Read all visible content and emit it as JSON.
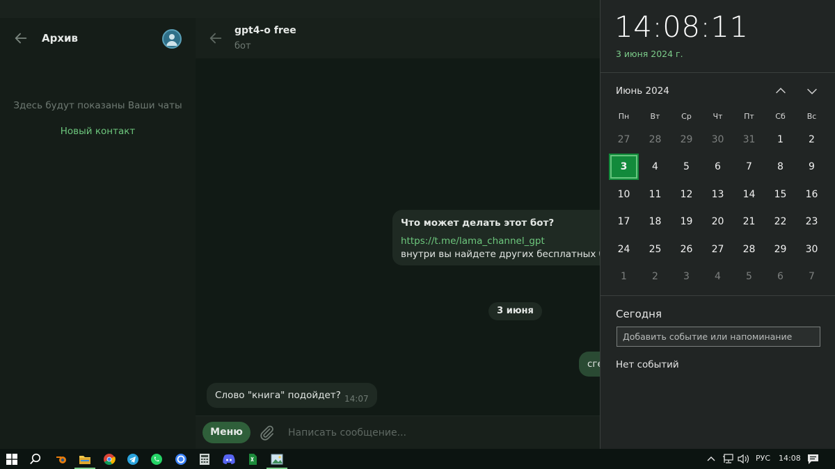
{
  "archive": {
    "title": "Архив",
    "empty_text": "Здесь будут показаны Ваши чаты",
    "new_contact": "Новый контакт"
  },
  "chat": {
    "name": "gpt4-o free",
    "status": "бот",
    "info_bubble": {
      "question": "Что может делать этот бот?",
      "link": "https://t.me/lama_channel_gpt",
      "description": "внутри вы найдете других бесплатных бо"
    },
    "date_divider": "3 июня",
    "outgoing_message": "сге",
    "incoming_message": {
      "text": "Слово \"книга\" подойдет?",
      "time": "14:07"
    },
    "composer": {
      "menu_label": "Меню",
      "placeholder": "Написать сообщение..."
    }
  },
  "calendar": {
    "time": "14:08:11",
    "date": "3 июня 2024 г.",
    "month_label": "Июнь 2024",
    "weekdays": [
      "Пн",
      "Вт",
      "Ср",
      "Чт",
      "Пт",
      "Сб",
      "Вс"
    ],
    "weeks": [
      [
        "27",
        "28",
        "29",
        "30",
        "31",
        "1",
        "2"
      ],
      [
        "3",
        "4",
        "5",
        "6",
        "7",
        "8",
        "9"
      ],
      [
        "10",
        "11",
        "12",
        "13",
        "14",
        "15",
        "16"
      ],
      [
        "17",
        "18",
        "19",
        "20",
        "21",
        "22",
        "23"
      ],
      [
        "24",
        "25",
        "26",
        "27",
        "28",
        "29",
        "30"
      ],
      [
        "1",
        "2",
        "3",
        "4",
        "5",
        "6",
        "7"
      ]
    ],
    "today_label": "Сегодня",
    "event_placeholder": "Добавить событие или напоминание",
    "no_events": "Нет событий"
  },
  "taskbar": {
    "language": "РУС",
    "clock": "14:08",
    "accent_color": "#7ccc8a"
  }
}
